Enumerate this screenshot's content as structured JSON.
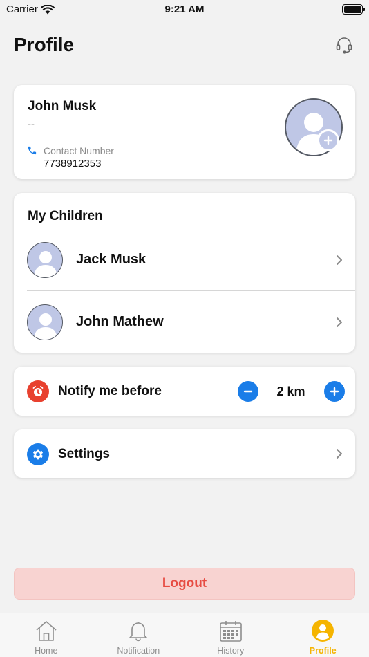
{
  "status_bar": {
    "carrier": "Carrier",
    "time": "9:21 AM"
  },
  "header": {
    "title": "Profile",
    "support_icon": "headset-icon"
  },
  "profile": {
    "name": "John Musk",
    "subtitle": "--",
    "contact_label": "Contact Number",
    "contact_value": "7738912353"
  },
  "children": {
    "title": "My Children",
    "items": [
      {
        "name": "Jack Musk"
      },
      {
        "name": "John Mathew"
      }
    ]
  },
  "notify": {
    "label": "Notify me before",
    "value": "2 km"
  },
  "settings": {
    "label": "Settings"
  },
  "logout": {
    "label": "Logout"
  },
  "tabs": [
    {
      "label": "Home",
      "icon": "home-icon"
    },
    {
      "label": "Notification",
      "icon": "bell-icon"
    },
    {
      "label": "History",
      "icon": "calendar-icon"
    },
    {
      "label": "Profile",
      "icon": "profile-icon",
      "active": true
    }
  ],
  "colors": {
    "accent": "#f5b400",
    "primary_blue": "#1a7de8",
    "alarm_red": "#e8412f",
    "logout_text": "#e74c43",
    "logout_bg": "#f8d3d1",
    "avatar_bg": "#bfc7e6"
  }
}
